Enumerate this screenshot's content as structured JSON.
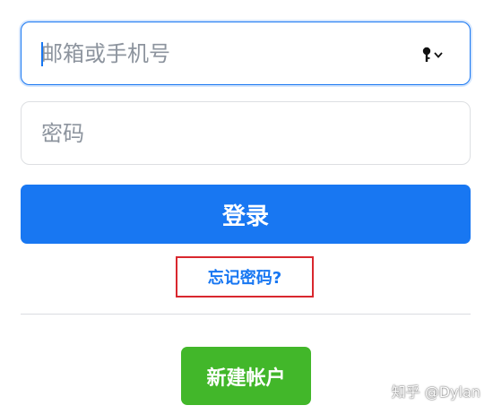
{
  "login_form": {
    "email_placeholder": "邮箱或手机号",
    "password_placeholder": "密码",
    "login_label": "登录",
    "forgot_label": "忘记密码?",
    "create_account_label": "新建帐户"
  },
  "watermark": "知乎 @Dylan",
  "colors": {
    "primary": "#1877f2",
    "success": "#42b72a",
    "highlight_border": "#d9272e",
    "placeholder": "#8d949e",
    "divider": "#dadde1"
  },
  "icons": {
    "password_manager": "key-dropdown-icon"
  }
}
